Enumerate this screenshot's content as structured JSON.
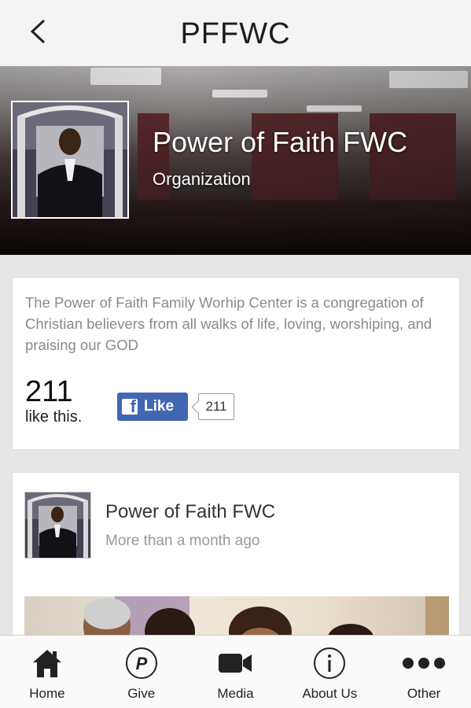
{
  "header": {
    "title": "PFFWC",
    "back_icon": "chevron-left-icon"
  },
  "cover": {
    "page_name": "Power of Faith FWC",
    "category": "Organization"
  },
  "about": {
    "description": "The Power of Faith Family Worhip Center is a congregation of Christian believers from all walks of life, loving, worshiping, and praising our GOD",
    "likes_count": "211",
    "likes_label": "like this.",
    "like_button_label": "Like",
    "like_button_count": "211",
    "brand_color": "#4267b2"
  },
  "post": {
    "author": "Power of Faith FWC",
    "time": "More than a month ago"
  },
  "tabs": [
    {
      "label": "Home",
      "icon": "home-icon"
    },
    {
      "label": "Give",
      "icon": "give-icon"
    },
    {
      "label": "Media",
      "icon": "video-camera-icon"
    },
    {
      "label": "About Us",
      "icon": "info-icon"
    },
    {
      "label": "Other",
      "icon": "more-dots-icon"
    }
  ]
}
